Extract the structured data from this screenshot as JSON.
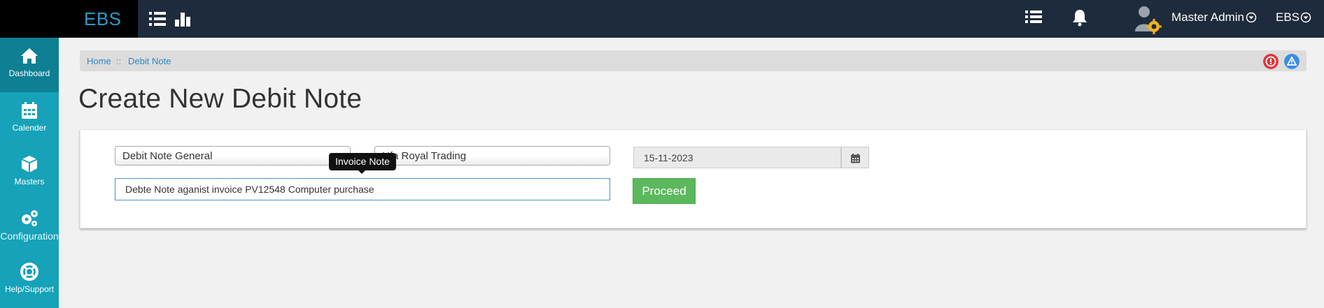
{
  "header": {
    "brand": "EBS",
    "user_name": "Master Admin",
    "app_menu": "EBS",
    "icons": [
      "list-icon",
      "bar-chart-icon",
      "list-icon",
      "bell-icon",
      "user-settings-icon"
    ]
  },
  "sidebar": {
    "items": [
      {
        "label": "Dashboard",
        "icon": "home-icon",
        "active": true
      },
      {
        "label": "Calender",
        "icon": "calendar-icon",
        "active": false
      },
      {
        "label": "Masters",
        "icon": "cube-icon",
        "active": false
      },
      {
        "label": "Configuration",
        "icon": "gears-icon",
        "active": false
      },
      {
        "label": "Help/Support",
        "icon": "lifebuoy-icon",
        "active": false
      }
    ]
  },
  "breadcrumb": {
    "home": "Home",
    "separator": "::",
    "current": "Debit Note"
  },
  "page": {
    "title": "Create New Debit Note"
  },
  "form": {
    "note_type": "Debit Note General",
    "party": "Ufa Royal Trading",
    "date": "15-11-2023",
    "note": "Debte Note aganist invoice PV12548 Computer purchase",
    "tooltip": "Invoice Note",
    "proceed_label": "Proceed"
  },
  "colors": {
    "topbar": "#1e2b3c",
    "sidebar": "#16a2b8",
    "brand": "#2a9cc8",
    "success": "#5cb85c",
    "alert_red": "#e0353a",
    "alert_blue": "#3c8de0"
  }
}
